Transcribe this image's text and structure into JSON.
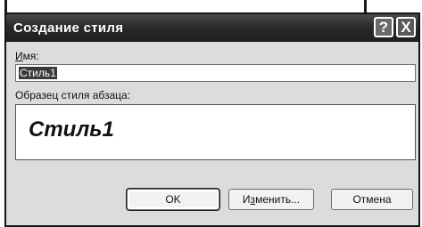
{
  "dialog": {
    "title": "Создание стиля",
    "help_symbol": "?",
    "close_symbol": "X"
  },
  "name": {
    "label_mnemonic": "И",
    "label_rest": "мя:",
    "value": "Стиль1"
  },
  "preview": {
    "label": "Образец стиля абзаца:",
    "text": "Стиль1"
  },
  "buttons": {
    "ok": "OK",
    "change_pre": "И",
    "change_mnemonic": "з",
    "change_post": "менить...",
    "cancel": "Отмена"
  },
  "colors": {
    "titlebar": "#2a2a2a",
    "dialog_bg": "#dcdcdc"
  }
}
